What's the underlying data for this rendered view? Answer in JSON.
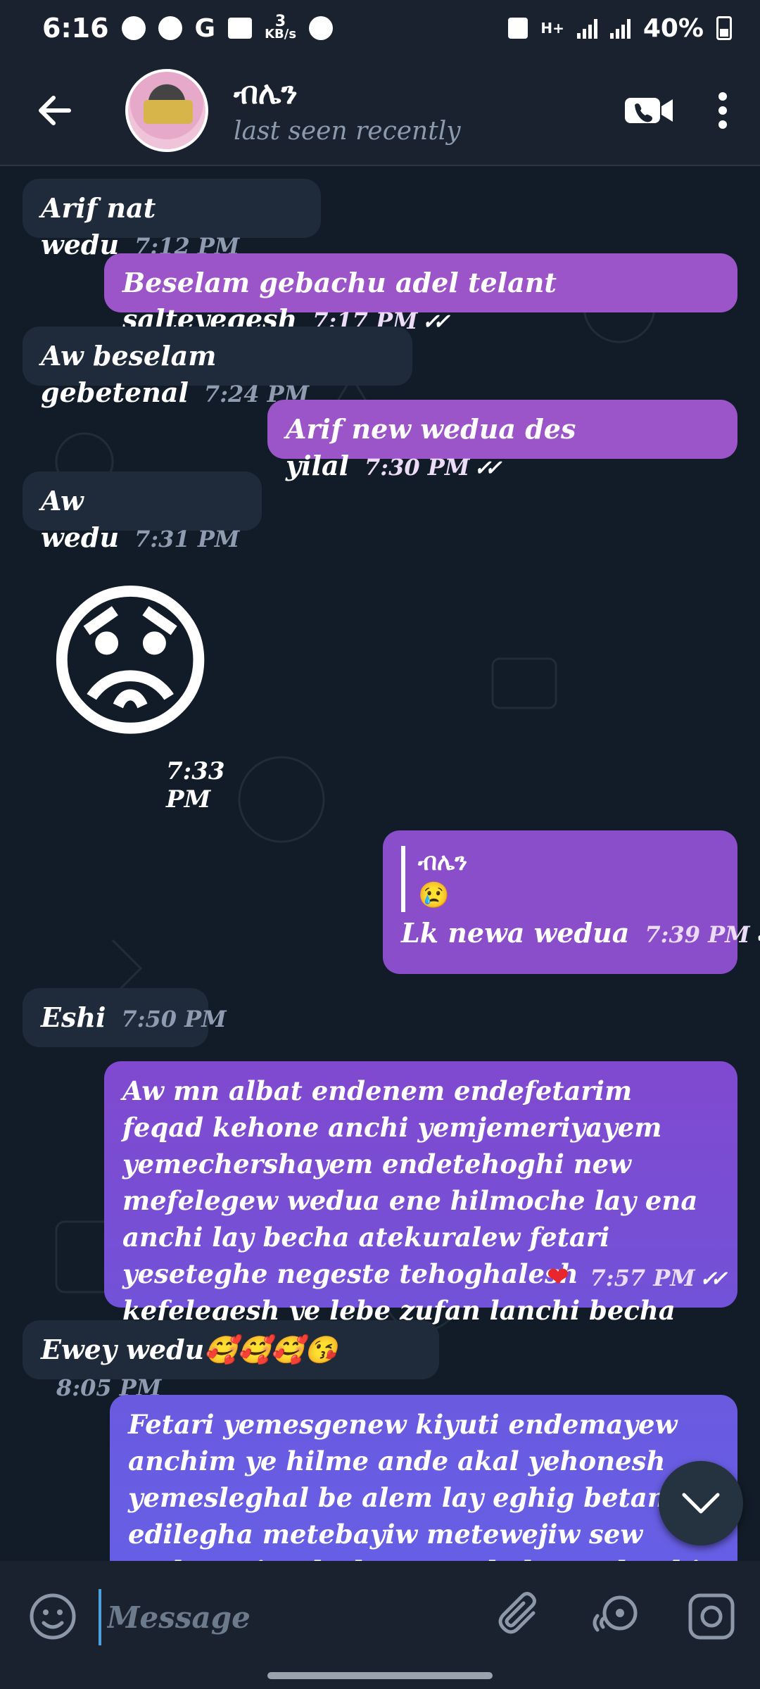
{
  "status_bar": {
    "time": "6:16",
    "net_speed_value": "3",
    "net_speed_unit": "KB/s",
    "network_type": "H+",
    "battery": "40%"
  },
  "header": {
    "title": "ብሌን",
    "subtitle": "last seen recently"
  },
  "messages": [
    {
      "dir": "in",
      "text": "Arif nat wedu",
      "time": "7:12 PM"
    },
    {
      "dir": "out",
      "text": "Beselam gebachu adel telant salteyeqesh",
      "time": "7:17 PM",
      "ticks": "✓✓"
    },
    {
      "dir": "in",
      "text": "Aw beselam gebetenal",
      "time": "7:24 PM"
    },
    {
      "dir": "out",
      "text": "Arif new wedua des yilal",
      "time": "7:30 PM",
      "ticks": "✓✓"
    },
    {
      "dir": "in",
      "text": "Aw wedu",
      "time": "7:31 PM"
    },
    {
      "dir": "in",
      "emoji": "😟",
      "time": "7:33 PM"
    },
    {
      "dir": "out",
      "reply_name": "ብሌን",
      "reply_emoji": "😢",
      "text": "Lk newa wedua",
      "time": "7:39 PM",
      "ticks": "✓✓"
    },
    {
      "dir": "in",
      "text": "Eshi",
      "time": "7:50 PM"
    },
    {
      "dir": "out",
      "text": "Aw mn albat endenem endefetarim feqad kehone anchi yemjemeriyayem yemechershayem endetehoghi new mefelegew wedua ene hilmoche lay ena anchi lay becha atekuralew fetari yeseteghe negeste tehoghalesh kefelegesh ye lebe zufan lanchi becha keft new wedua",
      "heart": "❤",
      "time": "7:57 PM",
      "ticks": "✓✓"
    },
    {
      "dir": "in",
      "text": "Ewey wedu🥰🥰🥰😘",
      "time": "8:05 PM"
    },
    {
      "dir": "out",
      "text": "Fetari yemesgenew kiyuti endemayew anchim ye hilme ande akal yehonesh yemesleghal be alem lay eghig betam edilegha metebayiw metewejiw sew meleso siwedesh ena ande lay sethoghi new wedua"
    }
  ],
  "input": {
    "placeholder": "Message"
  },
  "colors": {
    "outgoing_top": "#9b55c8",
    "outgoing_bottom": "#6f5fe0",
    "incoming": "#1f2b3a",
    "background": "#121c28"
  }
}
